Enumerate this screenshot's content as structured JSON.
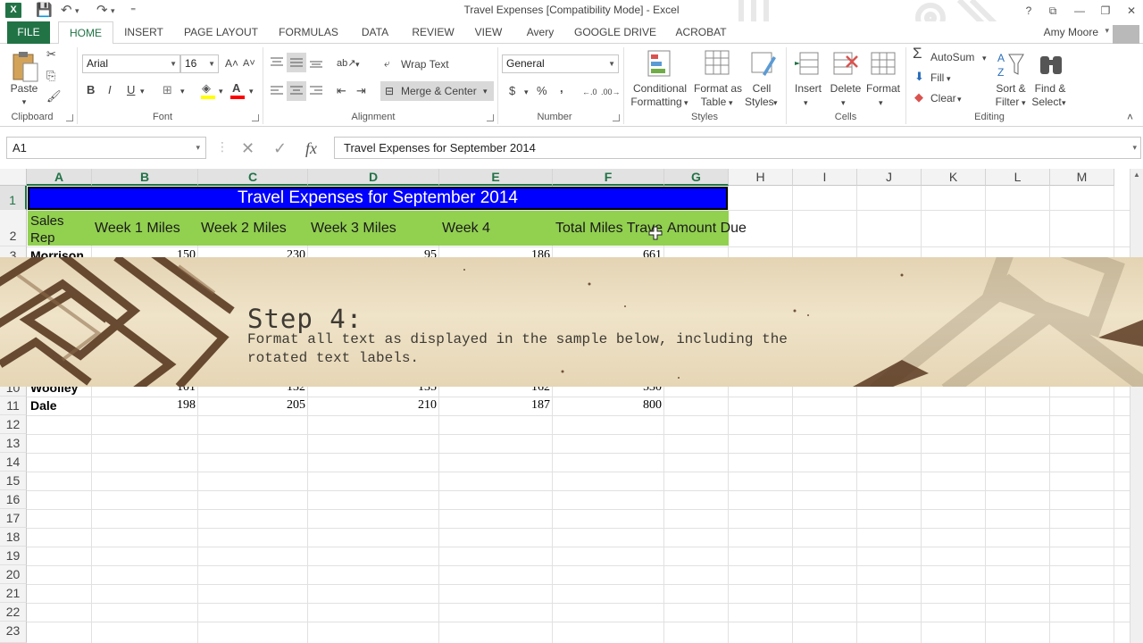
{
  "window": {
    "title": "Travel Expenses  [Compatibility Mode] - Excel",
    "help_glyph": "?",
    "ribbon_display_glyph": "⧉",
    "minimize_glyph": "—",
    "restore_glyph": "❐",
    "close_glyph": "✕",
    "app_logo_letter": "X"
  },
  "quick_access": {
    "save_glyph": "💾",
    "undo_glyph": "↶",
    "redo_glyph": "↷",
    "customize_glyph": "⁼"
  },
  "tabs": [
    {
      "label": "FILE"
    },
    {
      "label": "HOME"
    },
    {
      "label": "INSERT"
    },
    {
      "label": "PAGE LAYOUT"
    },
    {
      "label": "FORMULAS"
    },
    {
      "label": "DATA"
    },
    {
      "label": "REVIEW"
    },
    {
      "label": "VIEW"
    },
    {
      "label": "Avery"
    },
    {
      "label": "GOOGLE DRIVE"
    },
    {
      "label": "ACROBAT"
    }
  ],
  "active_tab": "HOME",
  "user": {
    "name": "Amy Moore",
    "caret": "▾"
  },
  "ribbon": {
    "clipboard": {
      "label": "Clipboard",
      "paste_label": "Paste",
      "paste_caret": "▾",
      "cut_glyph": "✂",
      "copy_glyph": "⎘",
      "painter_glyph": "🖌"
    },
    "font": {
      "label": "Font",
      "name": "Arial",
      "size": "16",
      "grow_glyph": "A˄",
      "shrink_glyph": "A˅",
      "bold": "B",
      "italic": "I",
      "underline": "U",
      "borders_glyph": "⊞",
      "fill_glyph": "◈",
      "color_glyph": "A"
    },
    "alignment": {
      "label": "Alignment",
      "wrap_text": "Wrap Text",
      "merge_center": "Merge & Center",
      "orientation_glyph": "ab↗",
      "indent_dec_glyph": "⇤",
      "indent_inc_glyph": "⇥"
    },
    "number": {
      "label": "Number",
      "format": "General",
      "currency": "$",
      "percent": "%",
      "comma": ",",
      "inc_decimal": "←.0",
      "dec_decimal": ".00→"
    },
    "styles": {
      "label": "Styles",
      "conditional": "Conditional",
      "formatting": "Formatting",
      "format_as": "Format as",
      "table": "Table",
      "cell": "Cell",
      "styles_word": "Styles",
      "caret": "▾"
    },
    "cells": {
      "label": "Cells",
      "insert": "Insert",
      "delete": "Delete",
      "format": "Format",
      "caret": "▾"
    },
    "editing": {
      "label": "Editing",
      "autosum": "AutoSum",
      "autosum_glyph": "Σ",
      "fill": "Fill",
      "fill_glyph": "⬇",
      "clear": "Clear",
      "clear_glyph": "◆",
      "sort_filter_1": "Sort &",
      "sort_filter_2": "Filter",
      "find_select_1": "Find &",
      "find_select_2": "Select",
      "caret": "▾"
    },
    "collapse_glyph": "˄"
  },
  "formula_bar": {
    "name_box": "A1",
    "caret": "▾",
    "cancel_glyph": "✕",
    "enter_glyph": "✓",
    "fx_glyph": "fx",
    "content": "Travel Expenses for September 2014"
  },
  "columns": [
    "A",
    "B",
    "C",
    "D",
    "E",
    "F",
    "G",
    "H",
    "I",
    "J",
    "K",
    "L",
    "M"
  ],
  "rows": [
    "1",
    "2",
    "3",
    "10",
    "11",
    "12",
    "13",
    "14",
    "15",
    "16",
    "17",
    "18",
    "19",
    "20",
    "21",
    "22",
    "23"
  ],
  "sheet": {
    "title": "Travel Expenses for September 2014",
    "headers": {
      "sales_rep_1": "Sales",
      "sales_rep_2": "Rep",
      "week1": "Week 1 Miles",
      "week2": "Week 2 Miles",
      "week3": "Week 3 Miles",
      "week4": "Week 4",
      "total": "Total Miles Travel",
      "amount": "Amount Due"
    },
    "data_rows": [
      {
        "name": "Morrison",
        "b": "150",
        "c": "230",
        "d": "95",
        "e": "186",
        "f": "661"
      },
      {
        "name": "Woolley",
        "b": "101",
        "c": "132",
        "d": "135",
        "e": "162",
        "f": "530"
      },
      {
        "name": "Dale",
        "b": "198",
        "c": "205",
        "d": "210",
        "e": "187",
        "f": "800"
      }
    ]
  },
  "overlay": {
    "step": "Step 4:",
    "line1": "Format all text as displayed in the sample below, including the",
    "line2": "rotated text labels."
  },
  "colors": {
    "excel_green": "#217346",
    "title_fill": "#0000FF",
    "header_fill": "#92D050",
    "banner_paper": "#E9DBBE",
    "banner_ink": "#3E3A33",
    "banner_brown": "#5A3A22"
  },
  "icons": [
    "excel-logo-icon",
    "save-icon",
    "undo-icon",
    "redo-icon",
    "paste-icon",
    "cut-icon",
    "copy-icon",
    "format-painter-icon",
    "bold-icon",
    "italic-icon",
    "underline-icon",
    "borders-icon",
    "fill-color-icon",
    "font-color-icon",
    "wrap-text-icon",
    "merge-center-icon",
    "conditional-formatting-icon",
    "format-as-table-icon",
    "cell-styles-icon",
    "insert-cells-icon",
    "delete-cells-icon",
    "format-cells-icon",
    "autosum-icon",
    "fill-icon",
    "clear-icon",
    "sort-filter-icon",
    "find-select-icon",
    "cell-cursor-icon"
  ]
}
